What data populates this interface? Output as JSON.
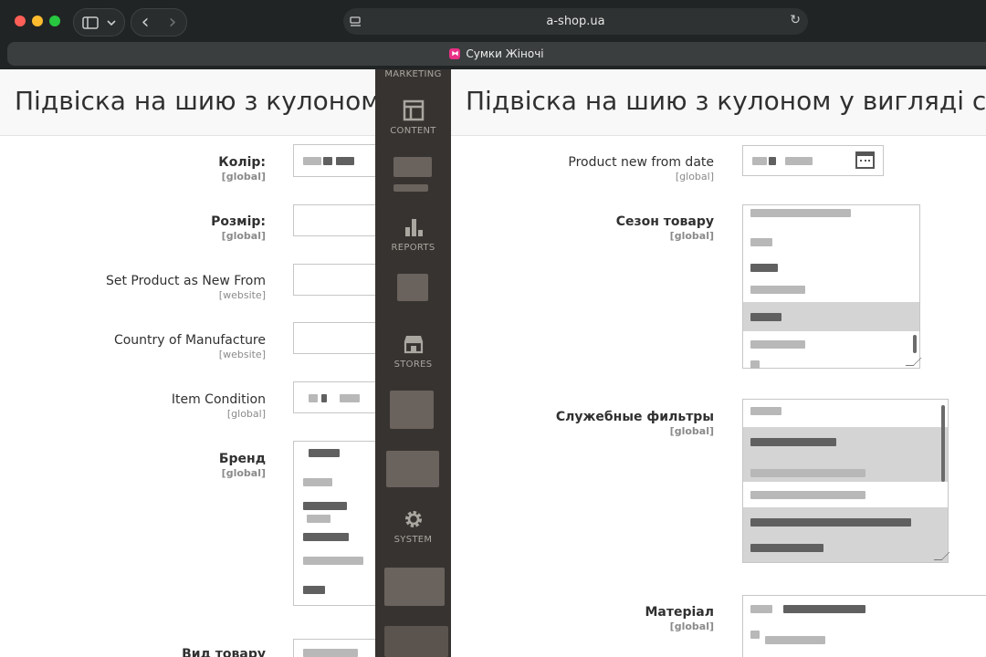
{
  "browser": {
    "url": "a-shop.ua",
    "tab_title": "Сумки Жіночі",
    "back_glyph": "‹",
    "forward_glyph": "›",
    "reload_glyph": "↻"
  },
  "left_panel": {
    "title": "Підвіска на шию з кулоном у",
    "fields": [
      {
        "label": "Колір:",
        "scope": "[global]"
      },
      {
        "label": "Розмір:",
        "scope": "[global]"
      },
      {
        "label": "Set Product as New From",
        "scope": "[website]"
      },
      {
        "label": "Country of Manufacture",
        "scope": "[website]"
      },
      {
        "label": "Item Condition",
        "scope": "[global]"
      },
      {
        "label": "Бренд",
        "scope": "[global]"
      },
      {
        "label": "Вид товару",
        "scope": ""
      }
    ]
  },
  "admin_nav": {
    "items": [
      {
        "label": "MARKETING",
        "icon": "megaphone-icon"
      },
      {
        "label": "CONTENT",
        "icon": "layout-icon"
      },
      {
        "label": "REPORTS",
        "icon": "bar-chart-icon"
      },
      {
        "label": "STORES",
        "icon": "storefront-icon"
      },
      {
        "label": "SYSTEM",
        "icon": "gear-icon"
      }
    ]
  },
  "right_panel": {
    "title": "Підвіска на шию з кулоном у вигляді сер...",
    "fields": [
      {
        "label": "Product new from date",
        "scope": "[global]"
      },
      {
        "label": "Сезон товару",
        "scope": "[global]"
      },
      {
        "label": "Служебные фильтры",
        "scope": "[global]"
      },
      {
        "label": "Матеріал",
        "scope": "[global]"
      }
    ]
  },
  "colors": {
    "nav_background": "#373330",
    "browser_chrome": "#212424",
    "selected_option": "#d4d4d4"
  }
}
